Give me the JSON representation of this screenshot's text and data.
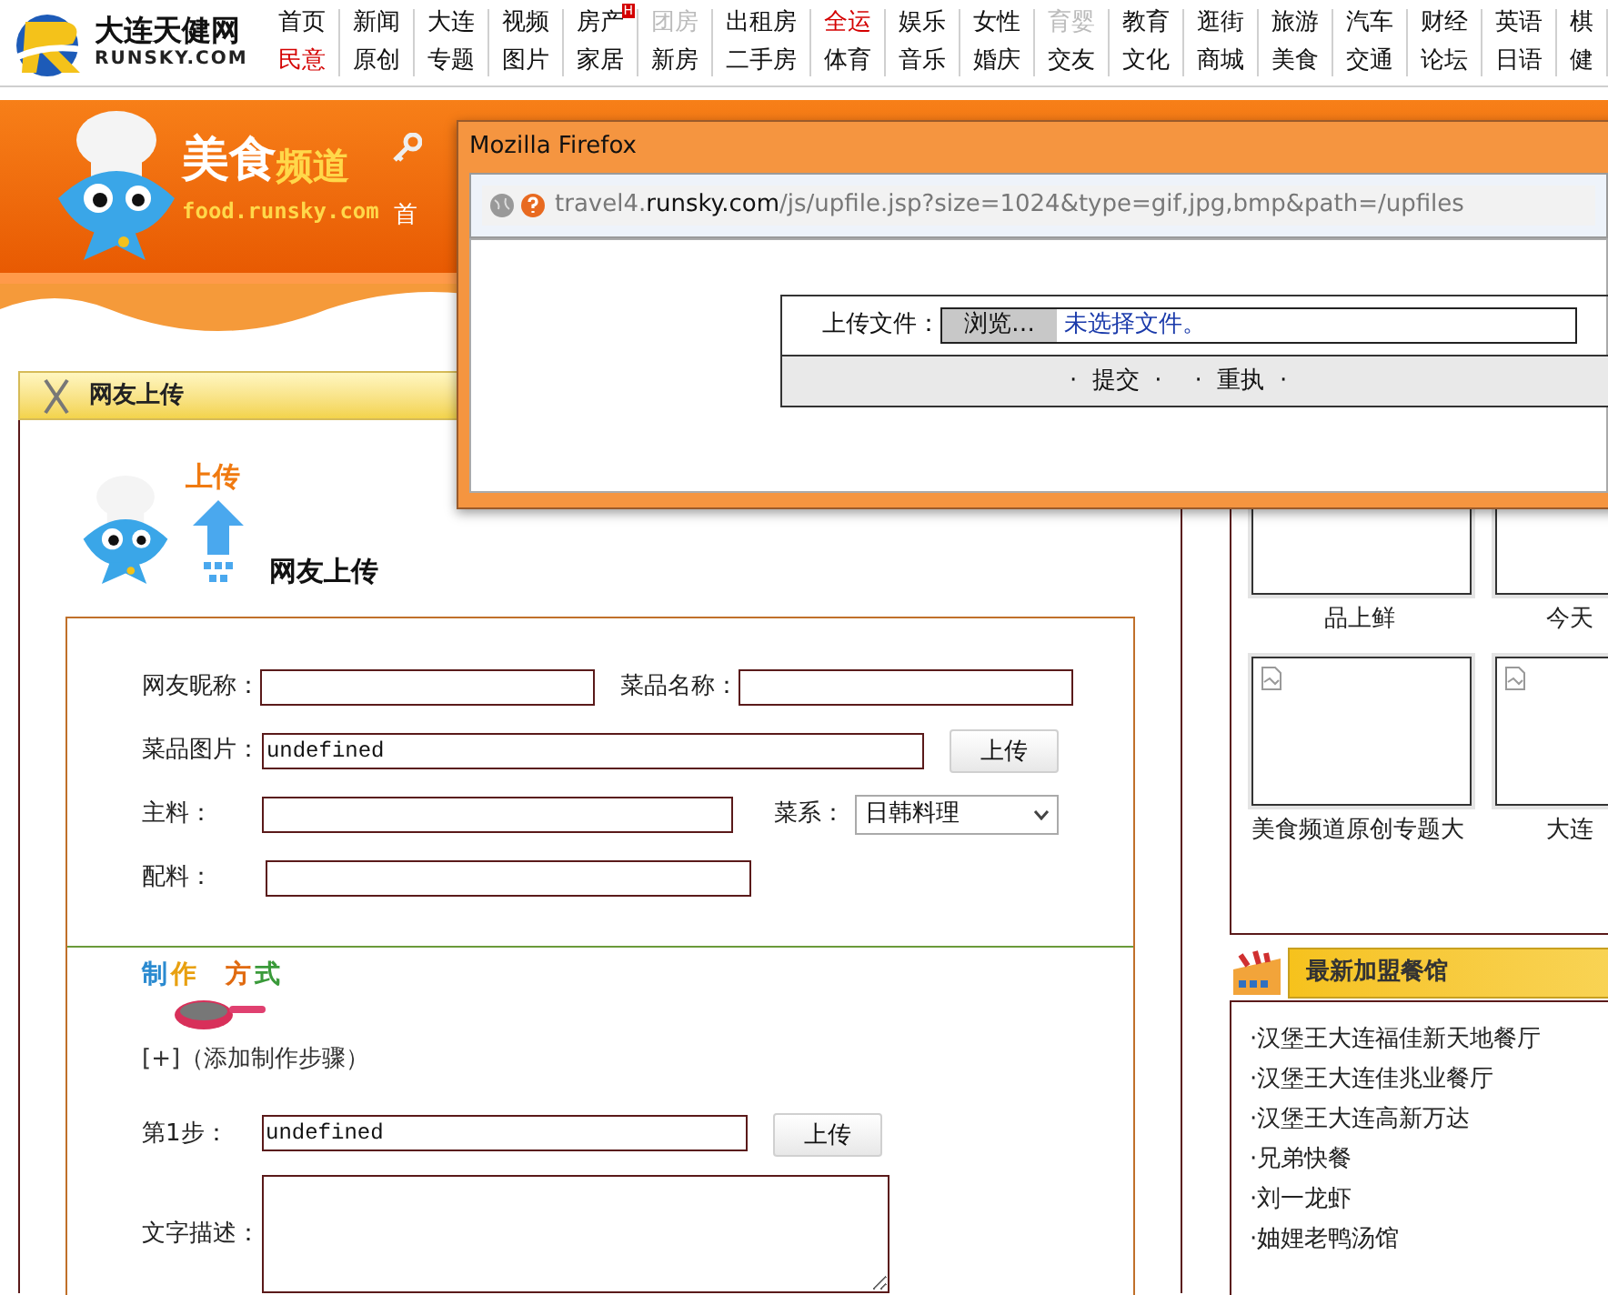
{
  "site_header": {
    "logo_name": "大连天健网",
    "logo_domain": "RUNSKY.COM",
    "nav_rows": [
      [
        {
          "label": "首页",
          "kind": "plain"
        },
        {
          "label": "新闻",
          "kind": "plain"
        },
        {
          "label": "大连",
          "kind": "plain"
        },
        {
          "label": "视频",
          "kind": "plain"
        },
        {
          "label": "房产",
          "kind": "plain",
          "badge": "H"
        },
        {
          "label": "团房",
          "kind": "disabled"
        },
        {
          "label": "出租房",
          "kind": "plain"
        },
        {
          "label": "全运",
          "kind": "featured"
        },
        {
          "label": "娱乐",
          "kind": "plain"
        },
        {
          "label": "女性",
          "kind": "plain"
        },
        {
          "label": "育婴",
          "kind": "disabled"
        },
        {
          "label": "教育",
          "kind": "plain"
        },
        {
          "label": "逛街",
          "kind": "plain"
        },
        {
          "label": "旅游",
          "kind": "plain"
        },
        {
          "label": "汽车",
          "kind": "plain"
        },
        {
          "label": "财经",
          "kind": "plain"
        },
        {
          "label": "英语",
          "kind": "plain"
        },
        {
          "label": "棋",
          "kind": "plain"
        }
      ],
      [
        {
          "label": "民意",
          "kind": "featured"
        },
        {
          "label": "原创",
          "kind": "plain"
        },
        {
          "label": "专题",
          "kind": "plain"
        },
        {
          "label": "图片",
          "kind": "plain"
        },
        {
          "label": "家居",
          "kind": "plain"
        },
        {
          "label": "新房",
          "kind": "plain"
        },
        {
          "label": "二手房",
          "kind": "plain"
        },
        {
          "label": "体育",
          "kind": "plain"
        },
        {
          "label": "音乐",
          "kind": "plain"
        },
        {
          "label": "婚庆",
          "kind": "plain"
        },
        {
          "label": "交友",
          "kind": "plain"
        },
        {
          "label": "文化",
          "kind": "plain"
        },
        {
          "label": "商城",
          "kind": "plain"
        },
        {
          "label": "美食",
          "kind": "plain"
        },
        {
          "label": "交通",
          "kind": "plain"
        },
        {
          "label": "论坛",
          "kind": "plain"
        },
        {
          "label": "日语",
          "kind": "plain"
        },
        {
          "label": "健",
          "kind": "plain"
        }
      ]
    ]
  },
  "channel_header": {
    "title_main": "美食",
    "title_sub": "频道",
    "domain": "food.runsky.com",
    "nav_first": "首"
  },
  "upload_section": {
    "title": "网友上传",
    "badge": "上传",
    "heading": "网友上传",
    "form_rows": [
      {
        "fields": [
          {
            "kind": "short",
            "label": "网友昵称："
          },
          {
            "kind": "short",
            "label": "菜品名称："
          }
        ]
      },
      {
        "fields": [
          {
            "kind": "upload",
            "label": "菜品图片：",
            "value": "undefined",
            "button": "上传"
          }
        ]
      },
      {
        "fields": [
          {
            "kind": "long",
            "label": "主料："
          },
          {
            "kind": "select",
            "label": "菜系：",
            "value": "日韩料理"
          }
        ]
      },
      {
        "fields": [
          {
            "kind": "long",
            "label": "配料："
          }
        ]
      }
    ]
  },
  "method_section": {
    "logo": "制作方式",
    "add_step": "[+]（添加制作步骤）",
    "step_label": "第1步：",
    "step_value": "undefined",
    "step_button": "上传",
    "description_label": "文字描述："
  },
  "sidebar": {
    "thumbnails": [
      {
        "caption": "品上鲜"
      },
      {
        "caption": "今天"
      },
      {
        "caption": "美食频道原创专题大",
        "broken": true
      },
      {
        "caption": "大连",
        "broken": true
      }
    ],
    "restaurants": {
      "title": "最新加盟餐馆",
      "items": [
        "·汉堡王大连福佳新天地餐厅",
        "·汉堡王大连佳兆业餐厅",
        "·汉堡王大连高新万达",
        "·兄弟快餐",
        "·刘一龙虾",
        "·妯娌老鸭汤馆"
      ]
    }
  },
  "popup": {
    "title": "Mozilla Firefox",
    "url_prefix": "travel4.",
    "url_domain": "runsky.com",
    "url_path": "/js/upfile.jsp?size=1024&type=gif,jpg,bmp&path=/upfiles",
    "file_label": "上传文件：",
    "browse": "浏览…",
    "no_file": "未选择文件。",
    "buttons": [
      "·  提交  ·",
      "·  重执  ·"
    ]
  }
}
